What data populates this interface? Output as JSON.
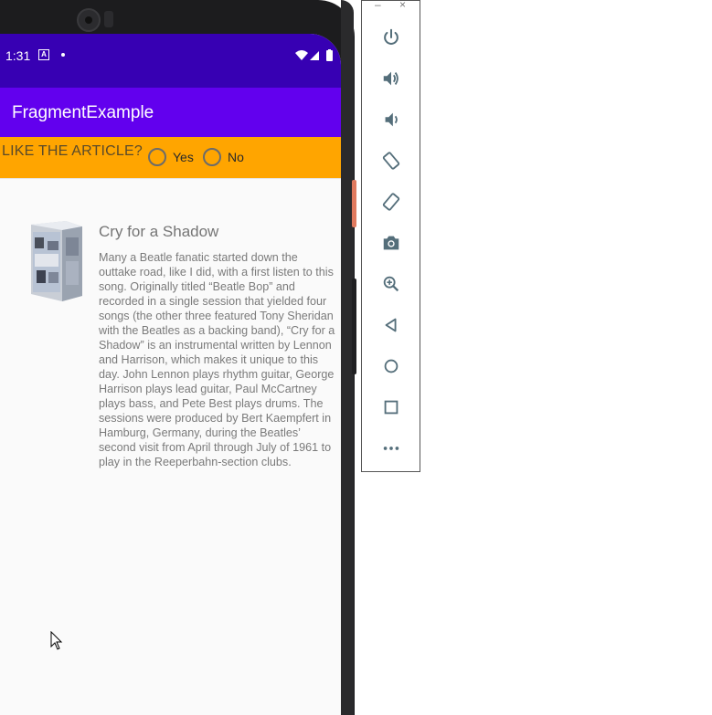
{
  "status_bar": {
    "time": "1:31",
    "notification_letter": "A"
  },
  "app_bar": {
    "title": "FragmentExample"
  },
  "feedback_bar": {
    "question": "LIKE THE ARTICLE?",
    "options": [
      {
        "label": "Yes",
        "selected": false
      },
      {
        "label": "No",
        "selected": false
      }
    ]
  },
  "article": {
    "title": "Cry for a Shadow",
    "body": "Many a Beatle fanatic started down the outtake road, like I did, with a first listen to this song. Originally titled “Beatle Bop” and recorded in a single session that yielded four songs (the other three featured Tony Sheridan with the Beatles as a backing band), “Cry for a Shadow” is an instrumental written by Lennon and Harrison, which makes it unique to this day. John Lennon plays rhythm guitar, George Harrison plays lead guitar, Paul McCartney plays bass, and Pete Best plays drums. The sessions were produced by Bert Kaempfert in Hamburg, Germany, during the Beatles’ second visit from April through July of 1961 to play in the Reeperbahn-section clubs."
  },
  "colors": {
    "status_bar": "#3700b3",
    "app_bar": "#6200ee",
    "feedback_bar": "#ffa500",
    "emulator_icons": "#546e7a"
  },
  "emulator_toolbar": {
    "window_controls": [
      "–",
      "×"
    ],
    "buttons": [
      {
        "icon": "power-icon"
      },
      {
        "icon": "volume-up-icon"
      },
      {
        "icon": "volume-down-icon"
      },
      {
        "icon": "rotate-left-icon"
      },
      {
        "icon": "rotate-right-icon"
      },
      {
        "icon": "camera-icon"
      },
      {
        "icon": "zoom-icon"
      },
      {
        "icon": "back-icon"
      },
      {
        "icon": "home-icon"
      },
      {
        "icon": "overview-icon"
      },
      {
        "icon": "more-icon"
      }
    ]
  }
}
